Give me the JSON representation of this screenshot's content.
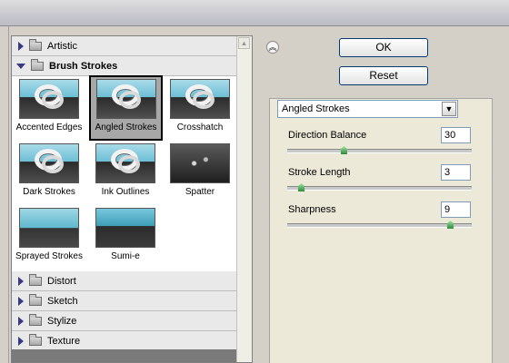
{
  "gallery": {
    "categories_top": [
      {
        "label": "Artistic",
        "expanded": false
      },
      {
        "label": "Brush Strokes",
        "expanded": true
      }
    ],
    "thumbnails": [
      {
        "label": "Accented Edges",
        "selected": false
      },
      {
        "label": "Angled Strokes",
        "selected": true
      },
      {
        "label": "Crosshatch",
        "selected": false
      },
      {
        "label": "Dark Strokes",
        "selected": false
      },
      {
        "label": "Ink Outlines",
        "selected": false
      },
      {
        "label": "Spatter",
        "selected": false
      },
      {
        "label": "Sprayed Strokes",
        "selected": false
      },
      {
        "label": "Sumi-e",
        "selected": false
      }
    ],
    "categories_bottom": [
      {
        "label": "Distort",
        "expanded": false
      },
      {
        "label": "Sketch",
        "expanded": false
      },
      {
        "label": "Stylize",
        "expanded": false
      },
      {
        "label": "Texture",
        "expanded": false
      }
    ]
  },
  "buttons": {
    "ok": "OK",
    "reset": "Reset"
  },
  "settings": {
    "filter_select": "Angled Strokes",
    "params": [
      {
        "label": "Direction Balance",
        "value": "30",
        "level": 30,
        "max": 100
      },
      {
        "label": "Stroke Length",
        "value": "3",
        "level": 3,
        "max": 50
      },
      {
        "label": "Sharpness",
        "value": "9",
        "level": 9,
        "max": 10
      }
    ]
  },
  "colors": {
    "panel_bg": "#ece9d8",
    "accent_border": "#003c74",
    "slider_thumb": "#2e8b38"
  }
}
